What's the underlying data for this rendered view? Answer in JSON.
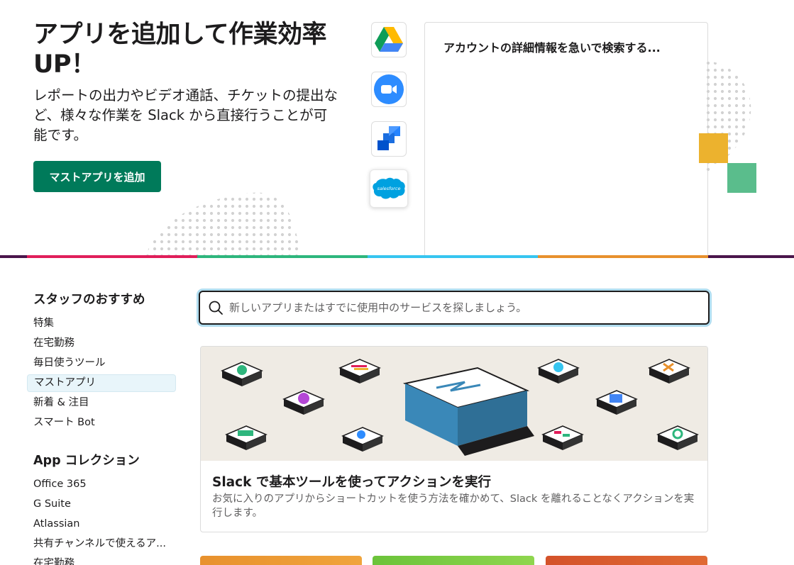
{
  "hero": {
    "title": "アプリを追加して作業効率UP！",
    "description": "レポートの出力やビデオ通話、チケットの提出など、様々な作業を Slack から直接行うことが可能です。",
    "cta_label": "マストアプリを追加",
    "apps": [
      {
        "name": "Google Drive",
        "icon": "google-drive-icon"
      },
      {
        "name": "Zoom",
        "icon": "zoom-icon"
      },
      {
        "name": "Jira",
        "icon": "jira-icon"
      },
      {
        "name": "Salesforce",
        "icon": "salesforce-icon",
        "logo_text": "salesforce",
        "selected": true
      }
    ],
    "preview_text": "アカウントの詳細情報を急いで検索する..."
  },
  "sidebar": {
    "staff_picks": {
      "heading": "スタッフのおすすめ",
      "items": [
        {
          "label": "特集"
        },
        {
          "label": "在宅勤務"
        },
        {
          "label": "毎日使うツール"
        },
        {
          "label": "マストアプリ",
          "selected": true
        },
        {
          "label": "新着 & 注目"
        },
        {
          "label": "スマート Bot"
        }
      ]
    },
    "collections": {
      "heading": "App コレクション",
      "items": [
        {
          "label": "Office 365"
        },
        {
          "label": "G Suite"
        },
        {
          "label": "Atlassian"
        },
        {
          "label": "共有チャンネルで使えるア..."
        },
        {
          "label": "在宅勤務"
        }
      ]
    }
  },
  "search": {
    "placeholder": "新しいアプリまたはすでに使用中のサービスを探しましょう。",
    "value": ""
  },
  "feature": {
    "title": "Slack で基本ツールを使ってアクションを実行",
    "description": "お気に入りのアプリからショートカットを使う方法を確かめて、Slack を離れることなくアクションを実行します。"
  },
  "colors": {
    "cta_green": "#007a5a",
    "stripe": [
      "#e01e5a",
      "#2eb67d",
      "#36c5f0",
      "#e8912d",
      "#4a154b"
    ],
    "deco_yellow": "#ecb22e",
    "deco_green": "#5abd8c",
    "mini_cards": [
      "#e8912d",
      "#6bc33a",
      "#d4522a"
    ]
  }
}
